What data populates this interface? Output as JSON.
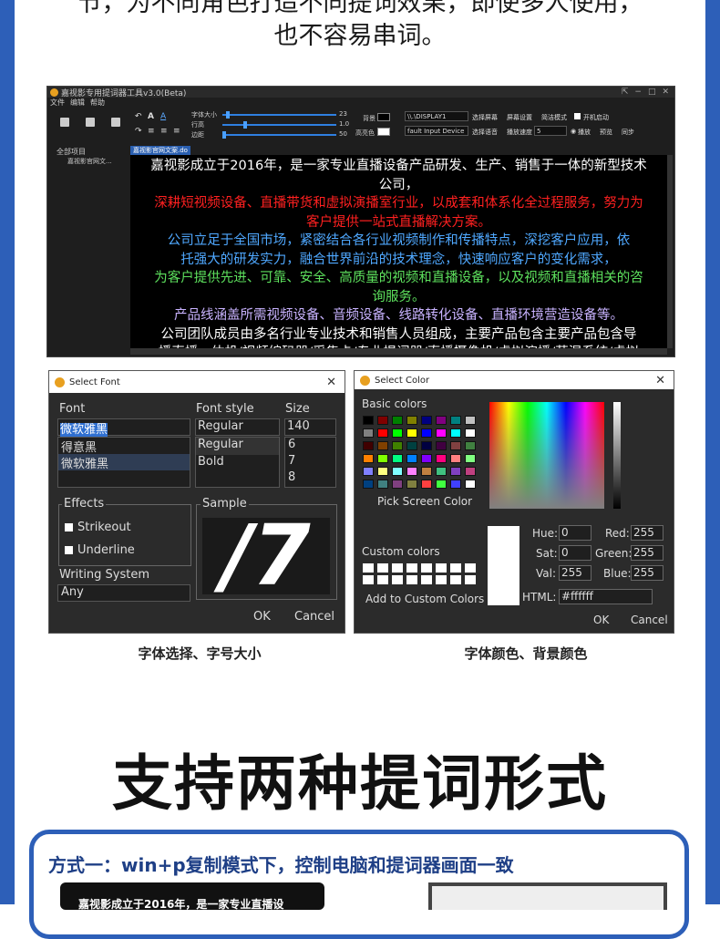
{
  "intro": {
    "line1": "节，为不同角色打造不同提词效果，即使多人使用，",
    "line2": "也不容易串词。"
  },
  "app": {
    "title": "嘉视影专用提词器工具v3.0(Beta)",
    "menu": [
      "文件",
      "编辑",
      "帮助"
    ],
    "window_controls": [
      "⇱",
      "−",
      "□",
      "✕"
    ],
    "sliders": [
      {
        "label": "字体大小",
        "value": "23"
      },
      {
        "label": "行高",
        "value": "1.0"
      },
      {
        "label": "边距",
        "value": "50"
      }
    ],
    "bg_label": "背景",
    "highlight_label": "高亮色",
    "display": "\\\\.\\DISPLAY1",
    "audio_device": "fault Input Device",
    "buttons_row1": [
      "选择屏幕",
      "屏幕设置",
      "简洁模式"
    ],
    "autostart_label": "开机启动",
    "buttons_row2": [
      "选择语音",
      "播放速度"
    ],
    "speed_value": "5",
    "play_label": "播放",
    "preview_label": "预览",
    "sync_label": "同步",
    "tree_root": "全部项目",
    "tree_item": "嘉视影官网文...",
    "doc_tab": "嘉视影官网文案.do",
    "doc_lines": [
      {
        "text": "嘉视影成立于2016年，是一家专业直播设备产品研发、生产、销售于一体的新型技术",
        "color": "#ffffff"
      },
      {
        "text": "公司，",
        "color": "#ffffff"
      },
      {
        "text": "深耕短视频设备、直播带货和虚拟演播室行业，以成套和体系化全过程服务，努力为",
        "color": "#ff2020"
      },
      {
        "text": "客户提供一站式直播解决方案。",
        "color": "#ff2020"
      },
      {
        "text": "公司立足于全国市场，紧密结合各行业视频制作和传播特点，深挖客户应用，依",
        "color": "#4fa8ff"
      },
      {
        "text": "托强大的研发实力，融合世界前沿的技术理念，快速响应客户的变化需求，",
        "color": "#4fa8ff"
      },
      {
        "text": "为客户提供先进、可靠、安全、高质量的视频和直播设备，以及视频和直播相关的咨",
        "color": "#5de05d"
      },
      {
        "text": "询服务。",
        "color": "#5de05d"
      },
      {
        "text": "产品线涵盖所需视频设备、音频设备、线路转化设备、直播环境营造设备等。",
        "color": "#c9b3ff"
      },
      {
        "text": "公司团队成员由多名行业专业技术和销售人员组成，主要产品包含主要产品包含导",
        "color": "#ffffff"
      },
      {
        "text": "播直播一体机/视频编码器/采集卡/专业提词器/直播摄像机/虚拟演播/荷湿系统/虚拟",
        "color": "#ffffff"
      }
    ]
  },
  "font_dialog": {
    "title": "Select Font",
    "font_label": "Font",
    "font_value": "微软雅黑",
    "font_list": [
      "得意黑",
      "微软雅黑"
    ],
    "style_label": "Font style",
    "style_value": "Regular",
    "style_list": [
      "Regular",
      "Bold"
    ],
    "size_label": "Size",
    "size_value": "140",
    "size_list": [
      "6",
      "7",
      "8"
    ],
    "effects_label": "Effects",
    "strikeout": "Strikeout",
    "underline": "Underline",
    "sample_label": "Sample",
    "sample_text": "/7",
    "writing_label": "Writing System",
    "writing_value": "Any",
    "ok": "OK",
    "cancel": "Cancel"
  },
  "color_dialog": {
    "title": "Select Color",
    "basic_colors_label": "Basic colors",
    "pick_screen": "Pick Screen Color",
    "custom_colors_label": "Custom colors",
    "add_custom": "Add to Custom Colors",
    "hue_label": "Hue:",
    "hue": "0",
    "sat_label": "Sat:",
    "sat": "0",
    "val_label": "Val:",
    "val": "255",
    "red_label": "Red:",
    "red": "255",
    "green_label": "Green:",
    "green": "255",
    "blue_label": "Blue:",
    "blue": "255",
    "html_label": "HTML:",
    "html": "#ffffff",
    "ok": "OK",
    "cancel": "Cancel",
    "basic_colors": [
      "#000000",
      "#800000",
      "#008000",
      "#808000",
      "#000080",
      "#800080",
      "#008080",
      "#c0c0c0",
      "#808080",
      "#ff0000",
      "#00ff00",
      "#ffff00",
      "#0000ff",
      "#ff00ff",
      "#00ffff",
      "#ffffff",
      "#400000",
      "#804000",
      "#408000",
      "#004040",
      "#000040",
      "#400040",
      "#804040",
      "#408040",
      "#ff8000",
      "#80ff00",
      "#00ff80",
      "#0080ff",
      "#8000ff",
      "#ff0080",
      "#ff8080",
      "#80ff80",
      "#8080ff",
      "#ffff80",
      "#80ffff",
      "#ff80ff",
      "#c08040",
      "#40c080",
      "#8040c0",
      "#c04080",
      "#004080",
      "#408080",
      "#804080",
      "#808040",
      "#ff4040",
      "#40ff40",
      "#4040ff",
      "#ffffff"
    ]
  },
  "captions": {
    "left": "字体选择、字号大小",
    "right": "字体颜色、背景颜色"
  },
  "heading": "支持两种提词形式",
  "method1": {
    "title": "方式一：win+p复制模式下，控制电脑和提词器画面一致",
    "screen_text": "嘉视影成立于2016年，是一家专业直播设"
  }
}
